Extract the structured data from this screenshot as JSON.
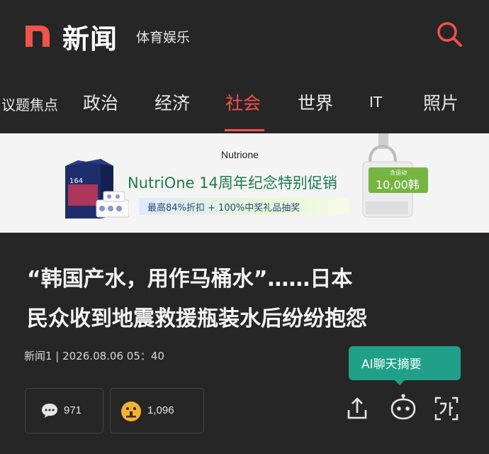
{
  "header": {
    "brand": "新闻",
    "section": "体育娱乐",
    "logo_icon": "n-logo-icon",
    "search_icon": "search-icon",
    "accent": "#f0524c"
  },
  "nav": {
    "items": [
      {
        "label": "议题焦点"
      },
      {
        "label": "政治"
      },
      {
        "label": "经济"
      },
      {
        "label": "社会",
        "active": true
      },
      {
        "label": "世界"
      },
      {
        "label": "IT"
      },
      {
        "label": "照片"
      }
    ]
  },
  "ad": {
    "brand": "Nutrione",
    "headline": "NutriOne 14周年纪念特别促销",
    "sub": "最高84%折扣 + 100%中奖礼品抽奖",
    "box_number": "164",
    "price_badge_small": "含运动",
    "price": "10,00韩"
  },
  "article": {
    "title_line1": "“韩国产水，用作马桶水”……日本",
    "title_line2": "民众收到地震救援瓶装水后纷纷抱怨",
    "meta": "新闻1 | 2026.08.06 05：40"
  },
  "ai_bubble": {
    "label": "AI聊天摘要",
    "color": "#20a088"
  },
  "stats": {
    "comments": "971",
    "reactions": "1,096"
  },
  "actions": {
    "share_icon": "share-icon",
    "ai_robot_icon": "robot-icon",
    "font_size_icon": "font-size-icon"
  }
}
